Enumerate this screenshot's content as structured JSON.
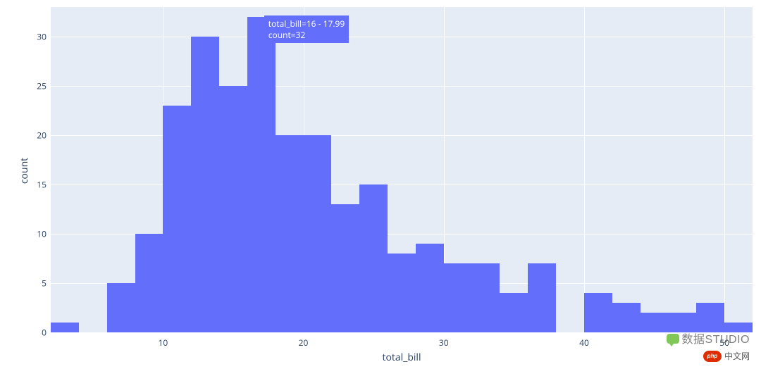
{
  "chart_data": {
    "type": "bar",
    "xlabel": "total_bill",
    "ylabel": "count",
    "xlim": [
      2,
      52
    ],
    "ylim": [
      0,
      33
    ],
    "bin_width": 2,
    "bins": [
      {
        "start": 2,
        "end": 4,
        "count": 1
      },
      {
        "start": 4,
        "end": 6,
        "count": 0
      },
      {
        "start": 6,
        "end": 8,
        "count": 5
      },
      {
        "start": 8,
        "end": 10,
        "count": 10
      },
      {
        "start": 10,
        "end": 12,
        "count": 23
      },
      {
        "start": 12,
        "end": 14,
        "count": 30
      },
      {
        "start": 14,
        "end": 16,
        "count": 25
      },
      {
        "start": 16,
        "end": 18,
        "count": 32
      },
      {
        "start": 18,
        "end": 20,
        "count": 20
      },
      {
        "start": 20,
        "end": 22,
        "count": 20
      },
      {
        "start": 22,
        "end": 24,
        "count": 13
      },
      {
        "start": 24,
        "end": 26,
        "count": 15
      },
      {
        "start": 26,
        "end": 28,
        "count": 8
      },
      {
        "start": 28,
        "end": 30,
        "count": 9
      },
      {
        "start": 30,
        "end": 32,
        "count": 7
      },
      {
        "start": 32,
        "end": 34,
        "count": 7
      },
      {
        "start": 34,
        "end": 36,
        "count": 4
      },
      {
        "start": 36,
        "end": 38,
        "count": 7
      },
      {
        "start": 38,
        "end": 40,
        "count": 0
      },
      {
        "start": 40,
        "end": 42,
        "count": 4
      },
      {
        "start": 42,
        "end": 44,
        "count": 3
      },
      {
        "start": 44,
        "end": 46,
        "count": 2
      },
      {
        "start": 46,
        "end": 48,
        "count": 2
      },
      {
        "start": 48,
        "end": 50,
        "count": 3
      },
      {
        "start": 50,
        "end": 52,
        "count": 1
      }
    ],
    "yticks": [
      0,
      5,
      10,
      15,
      20,
      25,
      30
    ],
    "xticks": [
      10,
      20,
      30,
      40,
      50
    ]
  },
  "tooltip": {
    "line1": "total_bill=16 - 17.99",
    "line2": "count=32"
  },
  "watermarks": {
    "studio": "数据STUDIO",
    "php": "php",
    "cn": "中文网"
  }
}
